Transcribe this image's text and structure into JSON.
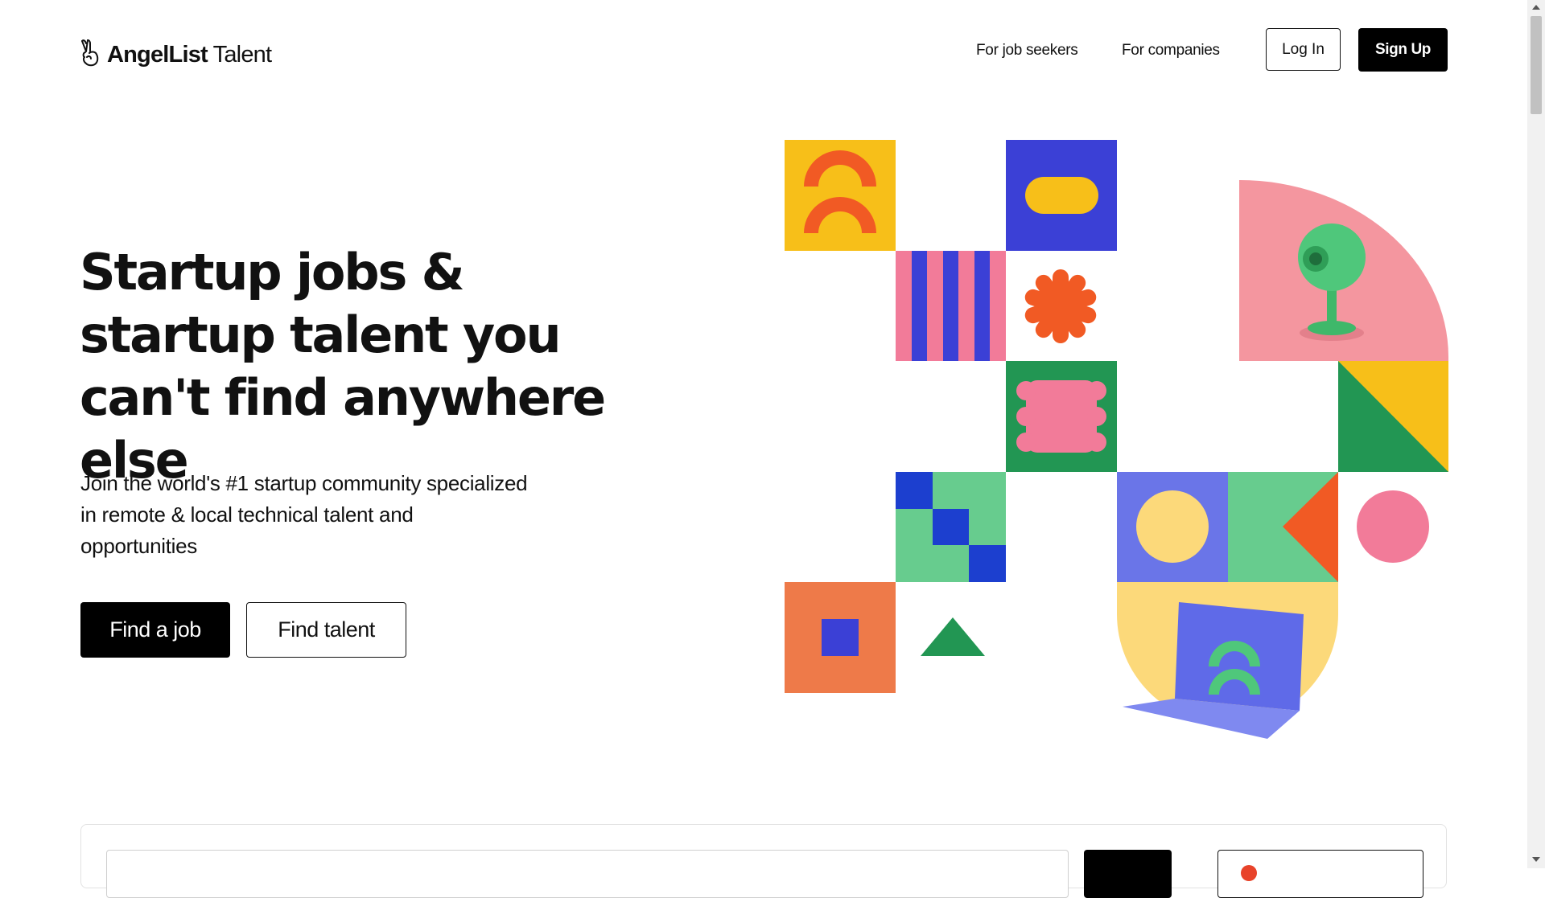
{
  "brand": {
    "name_bold": "AngelList",
    "name_light": " Talent",
    "icon": "victory-hand-icon"
  },
  "nav": {
    "job_seekers": "For job seekers",
    "companies": "For companies",
    "login": "Log In",
    "signup": "Sign Up"
  },
  "hero": {
    "title": "Startup jobs & startup talent you can't find anywhere else",
    "subtitle": "Join the world's #1 startup community specialized in remote & local technical talent and opportunities",
    "find_job": "Find a job",
    "find_talent": "Find talent"
  },
  "illustration": {
    "icons": [
      "double-arch-icon",
      "pill-icon",
      "stripes-icon",
      "asterisk-icon",
      "wavy-blob-icon",
      "webcam-icon",
      "triangle-icon",
      "checkerboard-icon",
      "circle-icon",
      "laptop-icon"
    ],
    "colors": {
      "yellow": "#f7bf19",
      "orange": "#f15a24",
      "blue": "#3b40d6",
      "pink": "#f27b99",
      "green": "#229653",
      "mint": "#67cc8e",
      "periwinkle": "#6a75e8",
      "sand": "#fcd97a",
      "coral": "#ee7a49",
      "rose": "#f4969f"
    }
  }
}
